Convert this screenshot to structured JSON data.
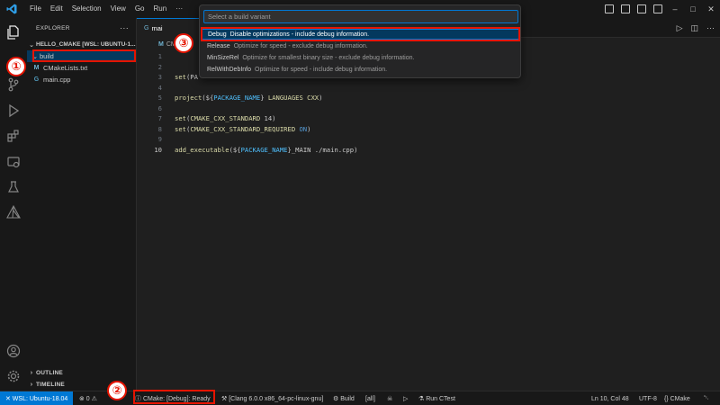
{
  "titlebar": {
    "menu": [
      "File",
      "Edit",
      "Selection",
      "View",
      "Go",
      "Run",
      "···"
    ],
    "window_controls": {
      "minimize": "–",
      "maximize": "□",
      "close": "✕"
    }
  },
  "activity_icons": [
    "explorer-icon",
    "search-icon",
    "source-control-icon",
    "run-debug-icon",
    "extensions-icon",
    "remote-explorer-icon",
    "testing-icon",
    "cmake-icon",
    "account-icon",
    "settings-gear-icon"
  ],
  "sidebar": {
    "title": "EXPLORER",
    "more": "···",
    "root": "HELLO_CMAKE [WSL: UBUNTU-1...",
    "items": [
      {
        "label": "build",
        "icon": "chevron-down-icon"
      },
      {
        "label": "CMakeLists.txt",
        "icon_glyph": "M"
      },
      {
        "label": "main.cpp",
        "icon_glyph": "G"
      }
    ],
    "outline": "OUTLINE",
    "timeline": "TIMELINE"
  },
  "editor": {
    "tab_label": "mai",
    "breadcrumb": "CM",
    "lines": [
      {
        "n": "1",
        "parts": [
          {
            "t": "",
            "c": "pl"
          }
        ]
      },
      {
        "n": "2",
        "parts": [
          {
            "t": "",
            "c": "pl"
          }
        ]
      },
      {
        "n": "3",
        "parts": [
          {
            "t": "set",
            "c": "fn"
          },
          {
            "t": "(PA",
            "c": "pl"
          }
        ]
      },
      {
        "n": "4",
        "parts": []
      },
      {
        "n": "5",
        "parts": [
          {
            "t": "project",
            "c": "fn"
          },
          {
            "t": "(${",
            "c": "pl"
          },
          {
            "t": "PACKAGE_NAME",
            "c": "vr"
          },
          {
            "t": "} ",
            "c": "pl"
          },
          {
            "t": "LANGUAGES CXX",
            "c": "fn"
          },
          {
            "t": ")",
            "c": "pl"
          }
        ]
      },
      {
        "n": "6",
        "parts": []
      },
      {
        "n": "7",
        "parts": [
          {
            "t": "set",
            "c": "fn"
          },
          {
            "t": "(",
            "c": "pl"
          },
          {
            "t": "CMAKE_CXX_STANDARD",
            "c": "fn"
          },
          {
            "t": " 14)",
            "c": "pl"
          }
        ]
      },
      {
        "n": "8",
        "parts": [
          {
            "t": "set",
            "c": "fn"
          },
          {
            "t": "(",
            "c": "pl"
          },
          {
            "t": "CMAKE_CXX_STANDARD_REQUIRED",
            "c": "fn"
          },
          {
            "t": " ",
            "c": "pl"
          },
          {
            "t": "ON",
            "c": "kw"
          },
          {
            "t": ")",
            "c": "pl"
          }
        ]
      },
      {
        "n": "9",
        "parts": []
      },
      {
        "n": "10",
        "parts": [
          {
            "t": "add_executable",
            "c": "fn"
          },
          {
            "t": "(${",
            "c": "pl"
          },
          {
            "t": "PACKAGE_NAME",
            "c": "vr"
          },
          {
            "t": "}_MAIN ./main.cpp)",
            "c": "pl"
          }
        ]
      }
    ]
  },
  "palette": {
    "placeholder": "Select a build variant",
    "options": [
      {
        "name": "Debug",
        "desc": "Disable optimizations - include debug information."
      },
      {
        "name": "Release",
        "desc": "Optimize for speed - exclude debug information."
      },
      {
        "name": "MinSizeRel",
        "desc": "Optimize for smallest binary size - exclude debug information."
      },
      {
        "name": "RelWithDebInfo",
        "desc": "Optimize for speed - include debug information."
      }
    ],
    "selected_index": 0
  },
  "annotations": [
    "①",
    "②",
    "③"
  ],
  "statusbar": {
    "remote": "✕ WSL: Ubuntu-18.04",
    "problems": "⊗ 0 ⚠",
    "cmake_status": "ⓘ CMake: [Debug]: Ready",
    "kit": "⚒ [Clang 6.0.0 x86_64-pc-linux-gnu]",
    "build": "⚙ Build",
    "target": "[all]",
    "debug": "☠",
    "run": "▷",
    "ctest": "⚗ Run CTest",
    "position": "Ln 10, Col 48",
    "encoding": "UTF-8",
    "language": "{} CMake",
    "bell": "␇"
  },
  "colors": {
    "accent": "#0078d4",
    "callout": "#e51400",
    "selection": "#04395e"
  }
}
